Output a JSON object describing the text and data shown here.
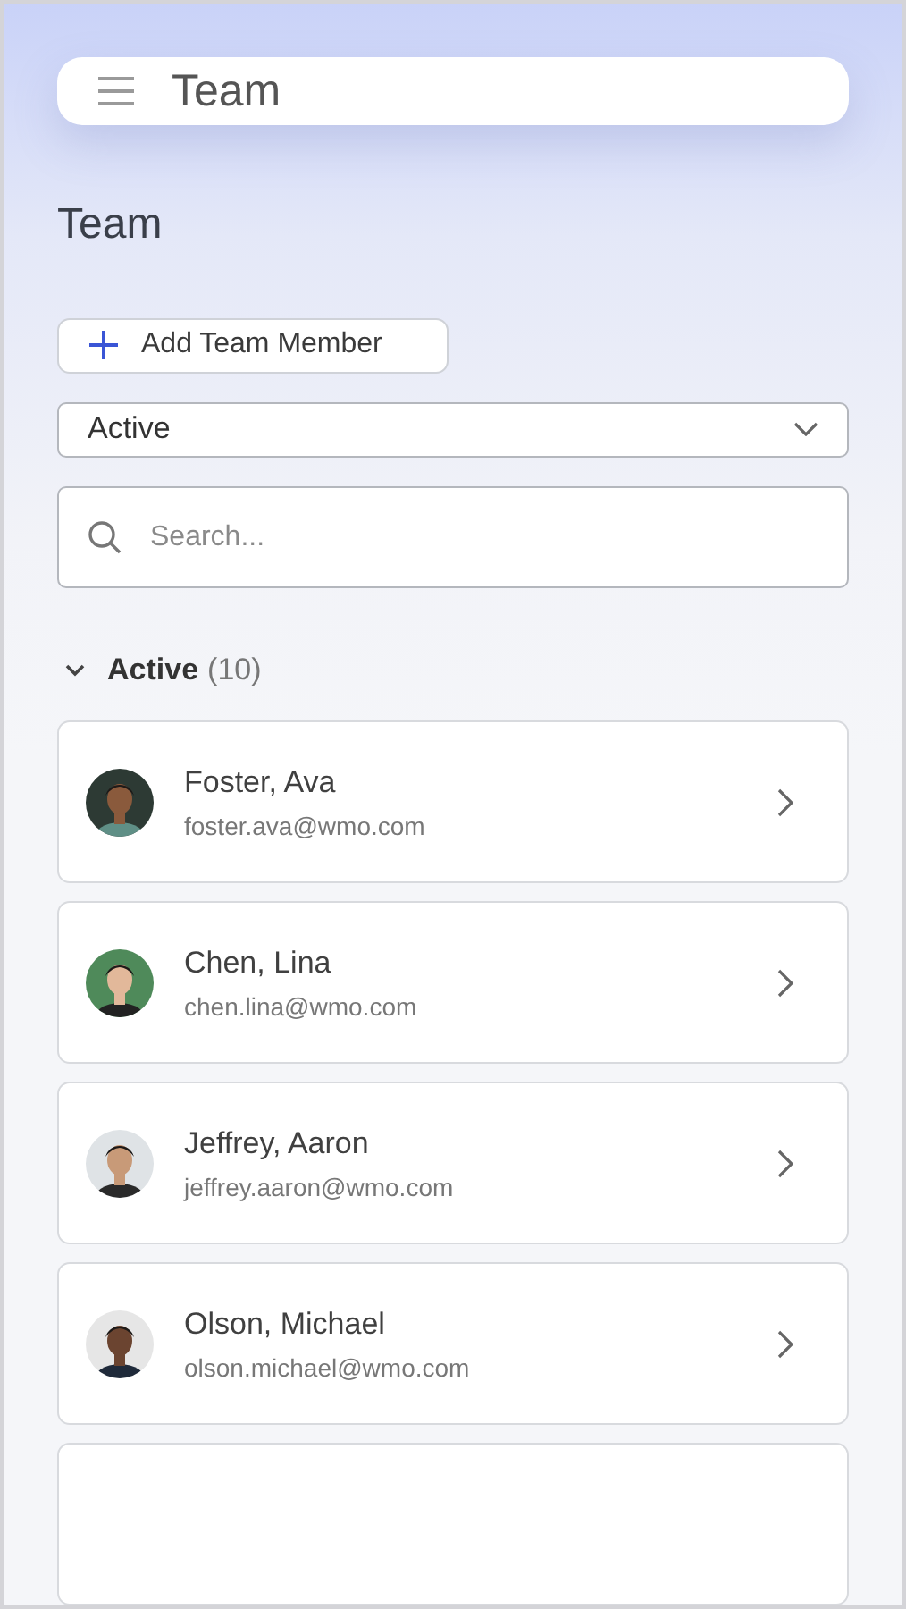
{
  "header": {
    "title": "Team"
  },
  "page_title": "Team",
  "add_button": {
    "label": "Add Team Member"
  },
  "status_filter": {
    "value": "Active"
  },
  "search": {
    "placeholder": "Search..."
  },
  "section": {
    "label": "Active",
    "count": "(10)",
    "expanded": true
  },
  "members": [
    {
      "name": "Foster, Ava",
      "email": "foster.ava@wmo.com"
    },
    {
      "name": "Chen, Lina",
      "email": "chen.lina@wmo.com"
    },
    {
      "name": "Jeffrey, Aaron",
      "email": "jeffrey.aaron@wmo.com"
    },
    {
      "name": "Olson, Michael",
      "email": "olson.michael@wmo.com"
    }
  ]
}
